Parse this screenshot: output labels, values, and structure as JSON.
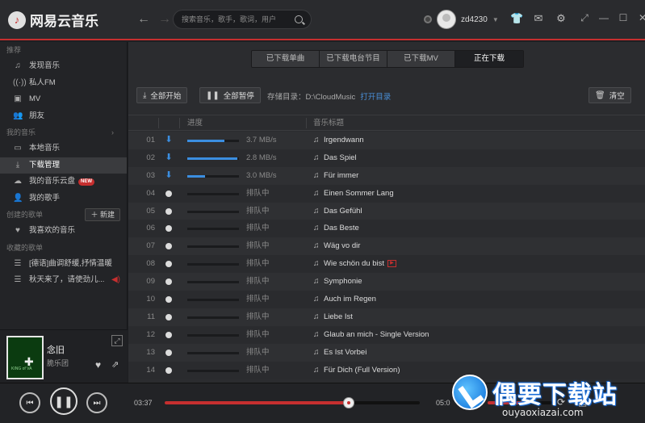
{
  "app": {
    "logo_text": "网易云音乐"
  },
  "search": {
    "placeholder": "搜索音乐，歌手，歌词，用户"
  },
  "user": {
    "name": "zd4230"
  },
  "sidebar": {
    "recommend_title": "推荐",
    "recommend": [
      {
        "icon": "music-note-icon",
        "label": "发现音乐"
      },
      {
        "icon": "radio-icon",
        "label": "私人FM"
      },
      {
        "icon": "mv-icon",
        "label": "MV"
      },
      {
        "icon": "friends-icon",
        "label": "朋友"
      }
    ],
    "my_music_title": "我的音乐",
    "my_music": [
      {
        "icon": "monitor-icon",
        "label": "本地音乐"
      },
      {
        "icon": "download-icon",
        "label": "下载管理"
      },
      {
        "icon": "cloud-icon",
        "label": "我的音乐云盘",
        "badge": "NEW"
      },
      {
        "icon": "artist-icon",
        "label": "我的歌手"
      }
    ],
    "created_title": "创建的歌单",
    "new_button": "新建",
    "created": [
      {
        "icon": "heart-icon",
        "label": "我喜欢的音乐"
      }
    ],
    "collected_title": "收藏的歌单",
    "collected": [
      {
        "icon": "playlist-icon",
        "label": "[德语]曲调舒缓,抒情温暖"
      },
      {
        "icon": "playlist-icon",
        "label": "秋天来了，请使劲儿..."
      }
    ]
  },
  "now_playing": {
    "title": "念旧",
    "artist": "脆乐团",
    "cover_text": "KING of VA"
  },
  "tabs": [
    "已下载单曲",
    "已下载电台节目",
    "已下载MV",
    "正在下载"
  ],
  "active_tab": 3,
  "toolbar": {
    "start_all": "全部开始",
    "pause_all": "全部暂停",
    "storage_label": "存储目录：",
    "storage_path": "D:\\CloudMusic",
    "open_dir": "打开目录",
    "clear": "清空"
  },
  "table": {
    "col_progress": "进度",
    "col_title": "音乐标题",
    "rows": [
      {
        "num": "01",
        "state": "downloading",
        "progress": 0.72,
        "status": "3.7 MB/s",
        "title": "Irgendwann"
      },
      {
        "num": "02",
        "state": "downloading",
        "progress": 0.97,
        "status": "2.8 MB/s",
        "title": "Das Spiel"
      },
      {
        "num": "03",
        "state": "downloading",
        "progress": 0.34,
        "status": "3.0 MB/s",
        "title": "Für immer"
      },
      {
        "num": "04",
        "state": "waiting",
        "progress": 0,
        "status": "排队中",
        "title": "Einen Sommer Lang"
      },
      {
        "num": "05",
        "state": "waiting",
        "progress": 0,
        "status": "排队中",
        "title": "Das Gefühl"
      },
      {
        "num": "06",
        "state": "waiting",
        "progress": 0,
        "status": "排队中",
        "title": "Das Beste"
      },
      {
        "num": "07",
        "state": "waiting",
        "progress": 0,
        "status": "排队中",
        "title": "Wäg vo dir"
      },
      {
        "num": "08",
        "state": "waiting",
        "progress": 0,
        "status": "排队中",
        "title": "Wie schön du bist",
        "mv": true
      },
      {
        "num": "09",
        "state": "waiting",
        "progress": 0,
        "status": "排队中",
        "title": "Symphonie"
      },
      {
        "num": "10",
        "state": "waiting",
        "progress": 0,
        "status": "排队中",
        "title": "Auch im Regen"
      },
      {
        "num": "11",
        "state": "waiting",
        "progress": 0,
        "status": "排队中",
        "title": "Liebe Ist"
      },
      {
        "num": "12",
        "state": "waiting",
        "progress": 0,
        "status": "排队中",
        "title": "Glaub an mich - Single Version"
      },
      {
        "num": "13",
        "state": "waiting",
        "progress": 0,
        "status": "排队中",
        "title": "Es Ist Vorbei"
      },
      {
        "num": "14",
        "state": "waiting",
        "progress": 0,
        "status": "排队中",
        "title": "Für Dich (Full Version)"
      }
    ]
  },
  "player": {
    "current_time": "03:37",
    "total_time": "05:0",
    "progress": 0.72,
    "volume": 0.55
  },
  "watermark": {
    "cn": "偶要下载站",
    "url": "ouyaoxiazai.com"
  },
  "colors": {
    "accent": "#c62f2f",
    "download_blue": "#3b8ee0"
  }
}
